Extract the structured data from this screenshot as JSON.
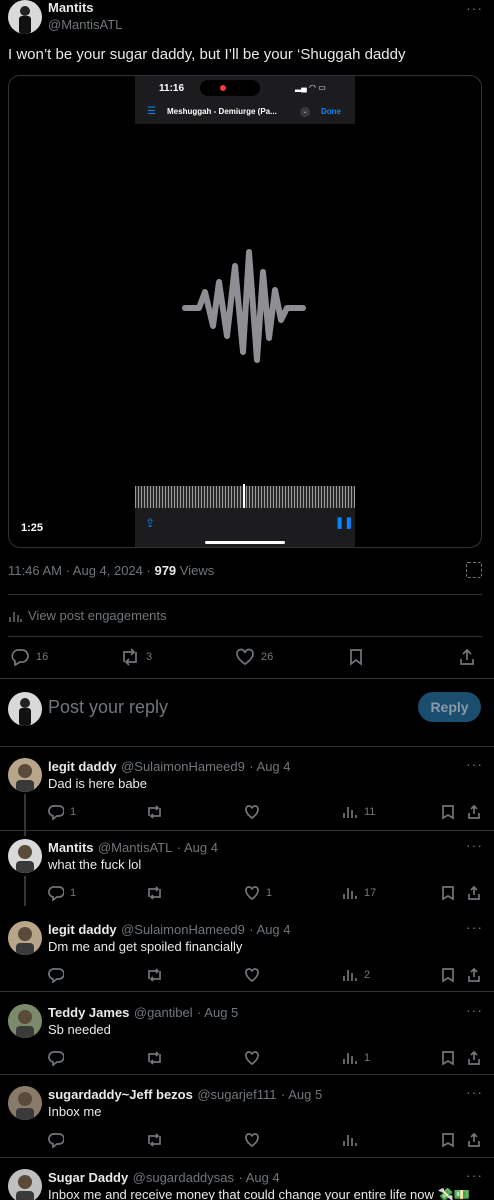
{
  "post": {
    "author_name": "Mantits",
    "author_handle": "@MantisATL",
    "text": "I won’t be your sugar daddy, but I’ll be your ‘Shuggah daddy",
    "video": {
      "phone_time": "11:16",
      "track_title": "Meshuggah - Demiurge (Pa...",
      "done_label": "Done",
      "duration": "1:25"
    },
    "timestamp": "11:46 AM · Aug 4, 2024 · ",
    "views_count": "979",
    "views_label": " Views",
    "engagements_label": "View post engagements",
    "stats": {
      "replies": "16",
      "reposts": "3",
      "likes": "26"
    }
  },
  "reply_box": {
    "placeholder": "Post your reply",
    "button_label": "Reply"
  },
  "replies": [
    {
      "name": "legit daddy",
      "handle": "@SulaimonHameed9",
      "date": "· Aug 4",
      "text": "Dad is here babe",
      "replies": "1",
      "reposts": "",
      "likes": "",
      "views": "11"
    },
    {
      "name": "Mantits",
      "handle": "@MantisATL",
      "date": "· Aug 4",
      "text": "what the fuck lol",
      "replies": "1",
      "reposts": "",
      "likes": "1",
      "views": "17"
    },
    {
      "name": "legit daddy",
      "handle": "@SulaimonHameed9",
      "date": "· Aug 4",
      "text": "Dm me and get spoiled financially",
      "replies": "",
      "reposts": "",
      "likes": "",
      "views": "2"
    },
    {
      "name": "Teddy James",
      "handle": "@gantibel",
      "date": "· Aug 5",
      "text": "Sb needed",
      "replies": "",
      "reposts": "",
      "likes": "",
      "views": "1"
    },
    {
      "name": "sugardaddy~Jeff bezos",
      "handle": "@sugarjef111",
      "date": "· Aug 5",
      "text": "Inbox me",
      "replies": "",
      "reposts": "",
      "likes": "",
      "views": ""
    },
    {
      "name": "Sugar Daddy",
      "handle": "@sugardaddysas",
      "date": "· Aug 4",
      "text": "Inbox me and receive money that could change your entire life now 💸💵",
      "replies": "",
      "reposts": "",
      "likes": "",
      "views": ""
    }
  ],
  "icons": {
    "more": "more-icon",
    "grok": "grok-icon",
    "reply": "reply-icon",
    "repost": "repost-icon",
    "like": "heart-icon",
    "views": "views-icon",
    "bookmark": "bookmark-icon",
    "share": "share-icon"
  },
  "colors": {
    "accent": "#1d9bf0",
    "reply_button_bg": "#1a4d6e",
    "muted": "#71767b",
    "divider": "#2f3336"
  }
}
